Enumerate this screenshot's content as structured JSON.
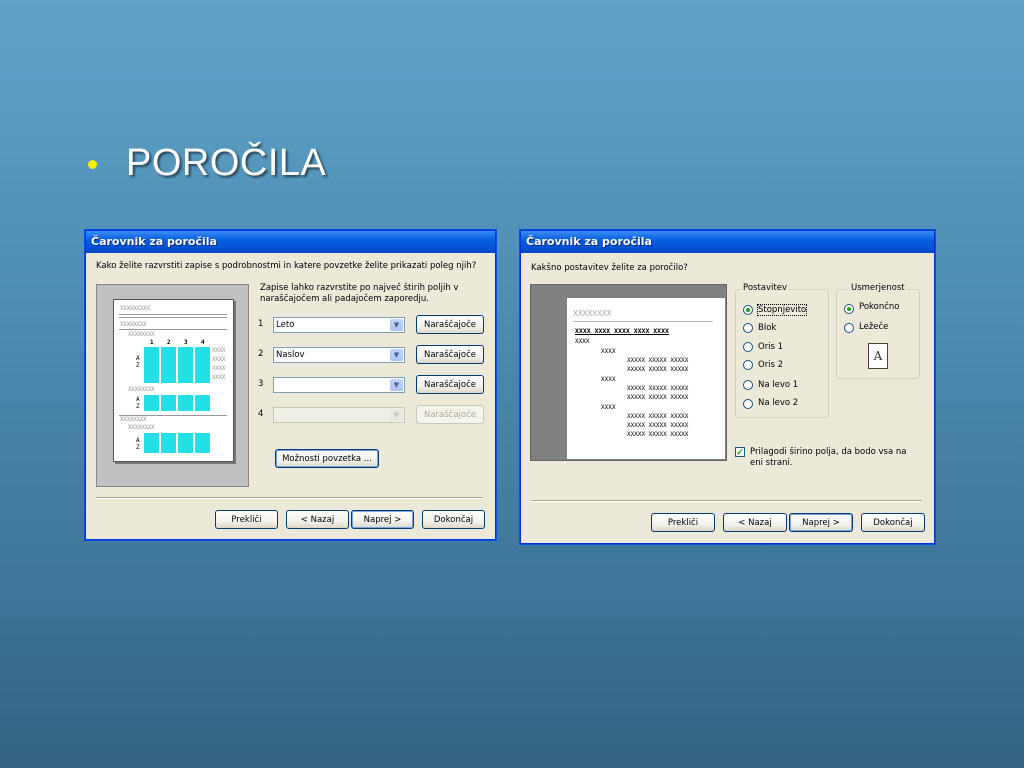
{
  "slide": {
    "bullet_color": "#f4f000",
    "title": "POROČILA"
  },
  "left_dialog": {
    "title": "Čarovnik za poročila",
    "prompt": "Kako želite razvrstiti zapise s podrobnostmi in katere povzetke želite prikazati poleg njih?",
    "hint_line1": "Zapise lahko razvrstite po največ štirih poljih v",
    "hint_line2": "naraščajočem ali padajočem zaporedju.",
    "sort_rows": [
      {
        "number": "1",
        "field": "Leto",
        "order": "Naraščajoče"
      },
      {
        "number": "2",
        "field": "Naslov",
        "order": "Naraščajoče"
      },
      {
        "number": "3",
        "field": "",
        "order": "Naraščajoče"
      },
      {
        "number": "4",
        "field": "",
        "order": "Naraščajoče"
      }
    ],
    "summary_button": "Možnosti povzetka ...",
    "preview": {
      "header": "XXXXXXXXX",
      "group": "XXXXXXXX",
      "col_numbers": [
        "1",
        "2",
        "3",
        "4"
      ],
      "sort_marker": "A Z",
      "cell": "XXXX"
    },
    "buttons": {
      "cancel": "Prekliči",
      "back": "< Nazaj",
      "next": "Naprej >",
      "finish": "Dokončaj"
    }
  },
  "right_dialog": {
    "title": "Čarovnik za poročila",
    "prompt": "Kakšno postavitev želite za poročilo?",
    "layout_group": "Postavitev",
    "layout_options": [
      "Stopnjevito",
      "Blok",
      "Oris 1",
      "Oris 2",
      "Na levo 1",
      "Na levo 2"
    ],
    "orientation_group": "Usmerjenost",
    "orientation_options": [
      "Pokončno",
      "Ležeče"
    ],
    "orientation_icon": "A",
    "fit_checkbox_line1": "Prilagodi širino polja, da bodo vsa na",
    "fit_checkbox_line2": "eni strani.",
    "preview": {
      "header": "XXXXXXXX",
      "columns": "XXXX  XXXX  XXXX  XXXX  XXXX",
      "row_a": "XXXX",
      "row_b": "XXXX",
      "row_c": "XXXXX  XXXXX  XXXXX"
    },
    "buttons": {
      "cancel": "Prekliči",
      "back": "< Nazaj",
      "next": "Naprej >",
      "finish": "Dokončaj"
    }
  }
}
